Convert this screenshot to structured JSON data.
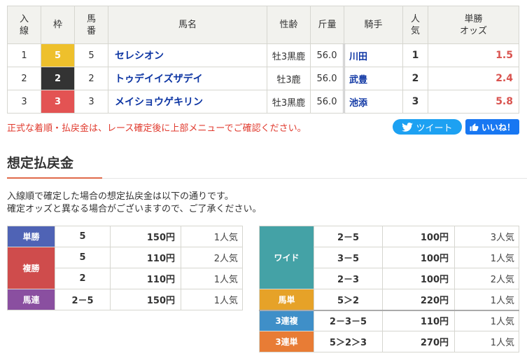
{
  "results": {
    "headers": {
      "rank": [
        "入",
        "線"
      ],
      "waku": "枠",
      "umaban": [
        "馬",
        "番"
      ],
      "name": "馬名",
      "sexage": "性齢",
      "weight": "斤量",
      "jockey": "騎手",
      "pop": [
        "人",
        "気"
      ],
      "odds": [
        "単勝",
        "オッズ"
      ]
    },
    "rows": [
      {
        "rank": "1",
        "waku": "5",
        "umaban": "5",
        "name": "セレシオン",
        "sexage": "牡3黒鹿",
        "weight": "56.0",
        "jockey": "川田",
        "pop": "1",
        "odds": "1.5"
      },
      {
        "rank": "2",
        "waku": "2",
        "umaban": "2",
        "name": "トゥデイイズザデイ",
        "sexage": "牡3鹿",
        "weight": "56.0",
        "jockey": "武豊",
        "pop": "2",
        "odds": "2.4"
      },
      {
        "rank": "3",
        "waku": "3",
        "umaban": "3",
        "name": "メイショウゲキリン",
        "sexage": "牡3黒鹿",
        "weight": "56.0",
        "jockey": "池添",
        "pop": "3",
        "odds": "5.8"
      }
    ]
  },
  "notice": "正式な着順・払戻金は、レース確定後に上部メニューでご確認ください。",
  "social": {
    "tweet": "ツイート",
    "like": "いいね！"
  },
  "payout": {
    "title": "想定払戻金",
    "desc": [
      "入線順で確定した場合の想定払戻金は以下の通りです。",
      "確定オッズと異なる場合がございますので、ご了承ください。"
    ],
    "left": {
      "tan": {
        "label": "単勝",
        "combo": "5",
        "yen": "150円",
        "pop": "1人気"
      },
      "fuku": {
        "label": "複勝",
        "rows": [
          {
            "combo": "5",
            "yen": "110円",
            "pop": "2人気"
          },
          {
            "combo": "2",
            "yen": "110円",
            "pop": "1人気"
          }
        ]
      },
      "uren": {
        "label": "馬連",
        "combo": "2－5",
        "yen": "150円",
        "pop": "1人気"
      }
    },
    "right": {
      "wide": {
        "label": "ワイド",
        "rows": [
          {
            "combo": "2－5",
            "yen": "100円",
            "pop": "3人気"
          },
          {
            "combo": "3－5",
            "yen": "100円",
            "pop": "1人気"
          },
          {
            "combo": "2－3",
            "yen": "100円",
            "pop": "2人気"
          }
        ]
      },
      "utan": {
        "label": "馬単",
        "combo": "5＞2",
        "yen": "220円",
        "pop": "1人気"
      },
      "fuku3": {
        "label": "3連複",
        "combo": "2－3－5",
        "yen": "110円",
        "pop": "1人気"
      },
      "tan3": {
        "label": "3連単",
        "combo": "5＞2＞3",
        "yen": "270円",
        "pop": "1人気"
      }
    }
  },
  "colors": {
    "accent_red": "#e03a2e",
    "link_blue": "#0d35a3",
    "odds_red": "#d9534f",
    "twitter": "#1da1f2",
    "facebook": "#1877f2"
  }
}
